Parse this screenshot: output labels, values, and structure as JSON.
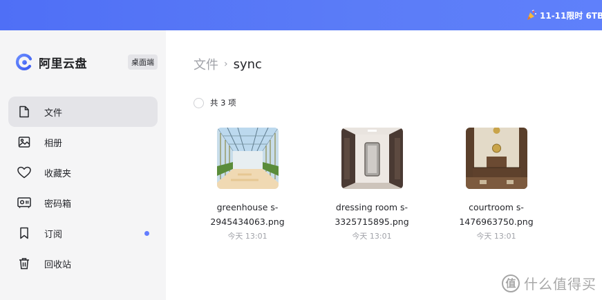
{
  "banner": {
    "promo_text": "11-11限时 6TB",
    "promo_icon": "party-popper-icon"
  },
  "sidebar": {
    "brand_name": "阿里云盘",
    "badge": "桌面端",
    "items": [
      {
        "label": "文件",
        "icon": "file-icon",
        "active": true
      },
      {
        "label": "相册",
        "icon": "photo-album-icon"
      },
      {
        "label": "收藏夹",
        "icon": "heart-icon"
      },
      {
        "label": "密码箱",
        "icon": "safe-box-icon"
      },
      {
        "label": "订阅",
        "icon": "bookmark-icon",
        "unread_dot": true
      },
      {
        "label": "回收站",
        "icon": "trash-icon"
      }
    ]
  },
  "breadcrumb": {
    "root": "文件",
    "separator": "›",
    "current": "sync"
  },
  "list": {
    "count_text": "共 3 项",
    "files": [
      {
        "name_line1": "greenhouse s-",
        "name_line2": "2945434063.png",
        "time": "今天 13:01"
      },
      {
        "name_line1": "dressing room s-",
        "name_line2": "3325715895.png",
        "time": "今天 13:01"
      },
      {
        "name_line1": "courtroom s-",
        "name_line2": "1476963750.png",
        "time": "今天 13:01"
      }
    ]
  },
  "watermark": {
    "mark": "值",
    "text": "什么值得买"
  },
  "colors": {
    "accent": "#637dff",
    "banner": "#5a7bf7",
    "sidebar_bg": "#f5f5f6",
    "active_item_bg": "#e4e4e8"
  }
}
